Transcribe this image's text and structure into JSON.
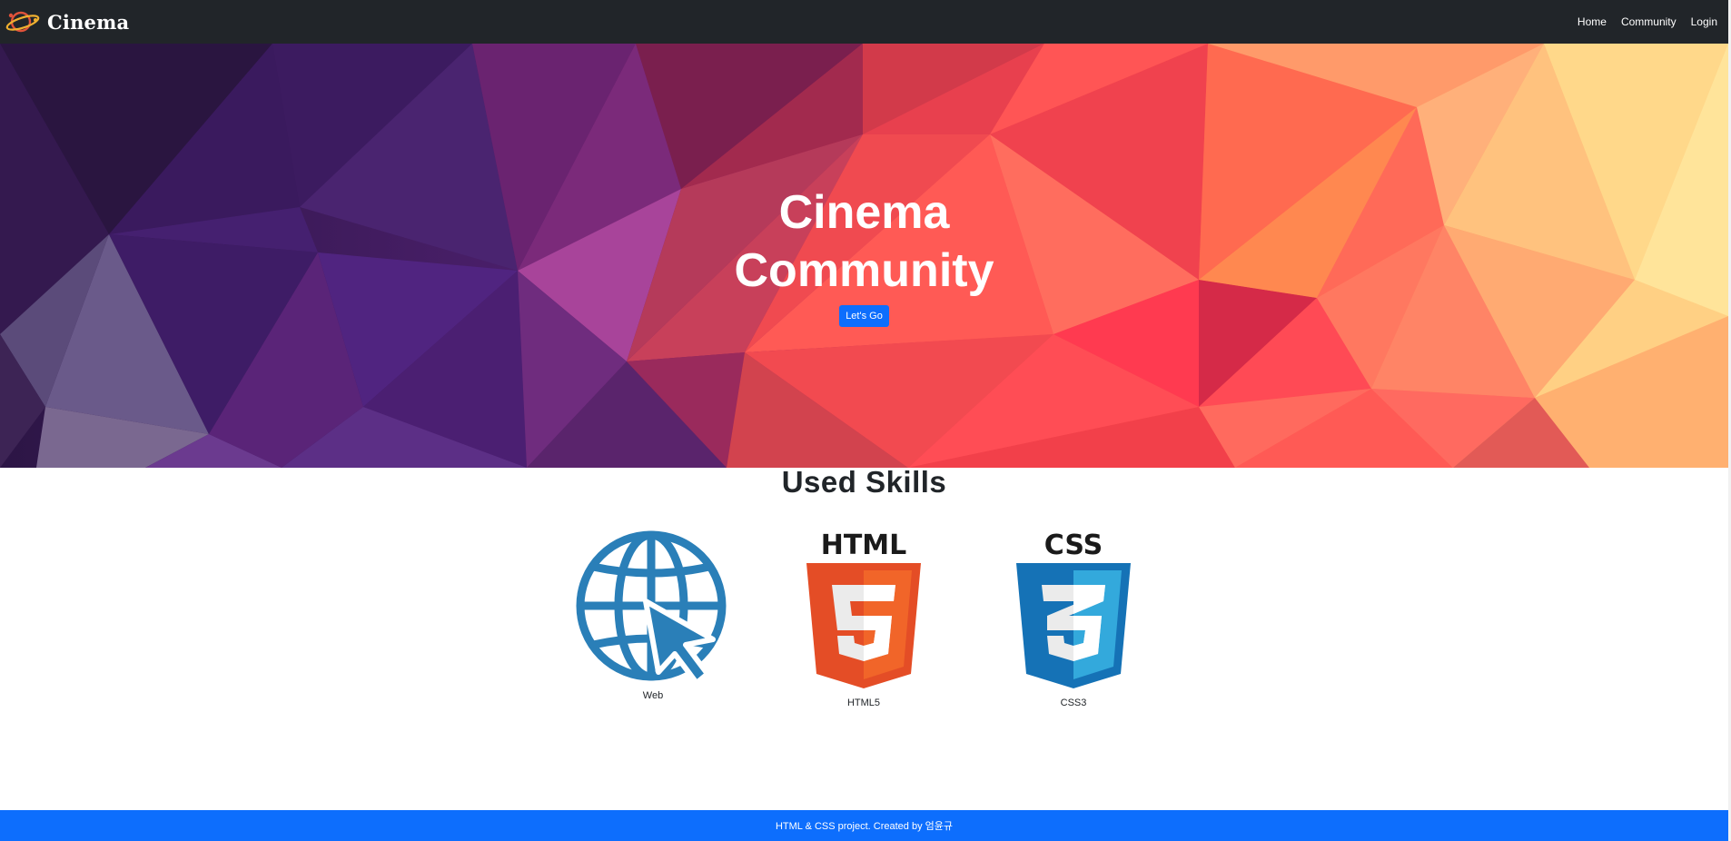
{
  "navbar": {
    "brand": "Cinema",
    "brand_icon": "planet-logo-icon",
    "links": [
      {
        "label": "Home"
      },
      {
        "label": "Community"
      },
      {
        "label": "Login"
      }
    ]
  },
  "hero": {
    "title_line1": "Cinema",
    "title_line2": "Community",
    "button_label": "Let's Go"
  },
  "skills": {
    "heading": "Used Skills",
    "items": [
      {
        "label": "Web",
        "icon": "globe-cursor-icon"
      },
      {
        "label": "HTML5",
        "icon": "html5-logo-icon"
      },
      {
        "label": "CSS3",
        "icon": "css3-logo-icon"
      }
    ]
  },
  "footer": {
    "text": "HTML & CSS project. Created by 엄윤규"
  },
  "colors": {
    "navbar_bg": "#212529",
    "primary": "#0d6efd",
    "web_icon": "#2a7fb8",
    "html_orange": "#e44d26",
    "css_blue": "#1572b6"
  }
}
